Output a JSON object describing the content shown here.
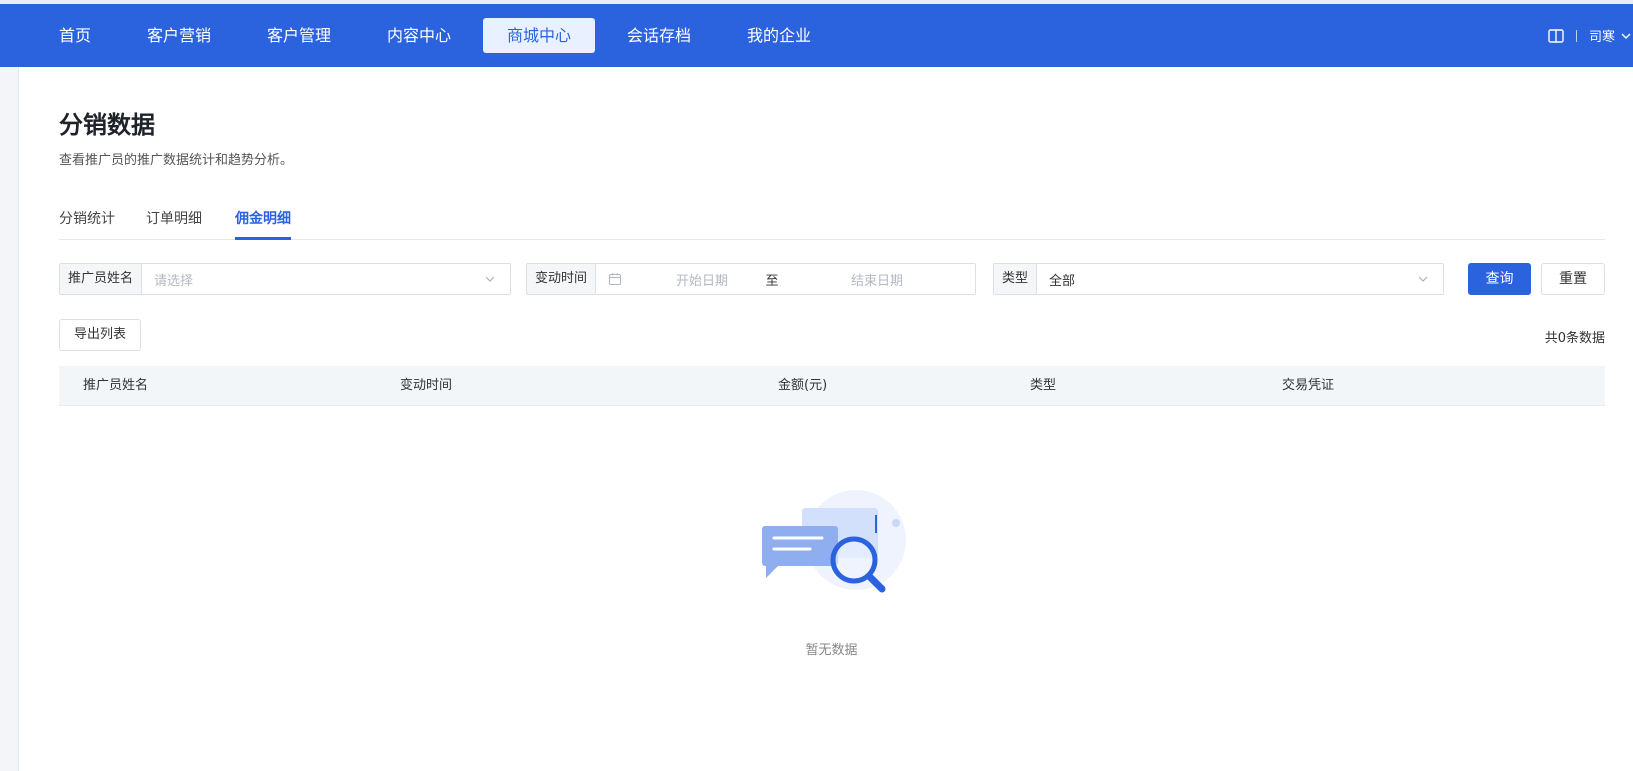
{
  "nav": {
    "items": [
      {
        "label": "首页"
      },
      {
        "label": "客户营销"
      },
      {
        "label": "客户管理"
      },
      {
        "label": "内容中心"
      },
      {
        "label": "商城中心"
      },
      {
        "label": "会话存档"
      },
      {
        "label": "我的企业"
      }
    ],
    "active_index": 4,
    "user": {
      "name": "司寒",
      "help_icon": "book-icon",
      "menu_icon": "chevron-down-icon"
    }
  },
  "page": {
    "title": "分销数据",
    "description": "查看推广员的推广数据统计和趋势分析。"
  },
  "tabs": [
    {
      "label": "分销统计"
    },
    {
      "label": "订单明细"
    },
    {
      "label": "佣金明细"
    }
  ],
  "active_tab": 2,
  "filters": {
    "promoter": {
      "label": "推广员姓名",
      "placeholder": "请选择"
    },
    "change_time": {
      "label": "变动时间",
      "start_placeholder": "开始日期",
      "separator": "至",
      "end_placeholder": "结束日期"
    },
    "type": {
      "label": "类型",
      "value": "全部"
    }
  },
  "buttons": {
    "query": "查询",
    "reset": "重置",
    "export": "导出列表"
  },
  "table": {
    "total_text": "共0条数据",
    "columns": [
      "推广员姓名",
      "变动时间",
      "金额(元)",
      "类型",
      "交易凭证"
    ],
    "rows": [],
    "empty_text": "暂无数据"
  },
  "colors": {
    "primary": "#2b62de",
    "nav_active_bg": "#e9f0ff",
    "table_header_bg": "#f3f6f9"
  }
}
